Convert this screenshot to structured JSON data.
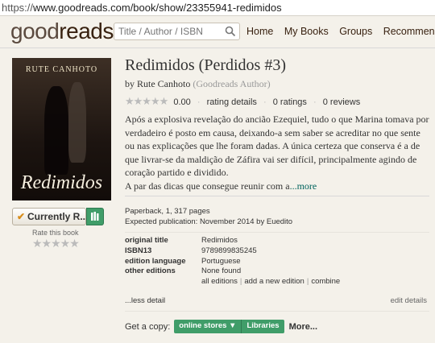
{
  "browser": {
    "url_proto": "https://",
    "url_rest": "www.goodreads.com/book/show/23355941-redimidos"
  },
  "header": {
    "logo_part1": "good",
    "logo_part2": "reads",
    "search_placeholder": "Title / Author / ISBN",
    "nav": [
      "Home",
      "My Books",
      "Groups",
      "Recommendatio"
    ]
  },
  "cover": {
    "author_text": "RUTE CANHOTO",
    "title_text": "Redimidos"
  },
  "shelf": {
    "status_label": "Currently R...",
    "rate_label": "Rate this book",
    "rate_stars": "★★★★★"
  },
  "book": {
    "title": "Redimidos (Perdidos #3)",
    "by": "by",
    "author": "Rute Canhoto",
    "author_tag": "(Goodreads Author)",
    "stars": "★★★★★",
    "avg_rating": "0.00",
    "rating_details": "rating details",
    "ratings": "0 ratings",
    "reviews": "0 reviews",
    "description": "Após a explosiva revelação do ancião Ezequiel, tudo o que Marina tomava por verdadeiro é posto em causa, deixando-a sem saber se acreditar no que sente ou nas explicações que lhe foram dadas. A única certeza que conserva é a de que livrar-se da maldição de Záfira vai ser difícil, principalmente agindo de coração partido e dividido.",
    "description_tail": "A par das dicas que consegue reunir com a",
    "more_link": "...more",
    "format": "Paperback, 1, 317 pages",
    "publication": "Expected publication: November 2014 by Euedito",
    "attributes": [
      {
        "label": "original title",
        "value": "Redimidos"
      },
      {
        "label": "ISBN13",
        "value": "9789899835245"
      },
      {
        "label": "edition language",
        "value": "Portuguese"
      },
      {
        "label": "other editions",
        "value": "None found"
      }
    ],
    "edition_links": [
      "all editions",
      "add a new edition",
      "combine"
    ],
    "less_detail": "...less detail",
    "edit_details": "edit details",
    "get_copy_label": "Get a copy:",
    "online_stores": "online stores ▼",
    "libraries": "Libraries",
    "more": "More..."
  }
}
